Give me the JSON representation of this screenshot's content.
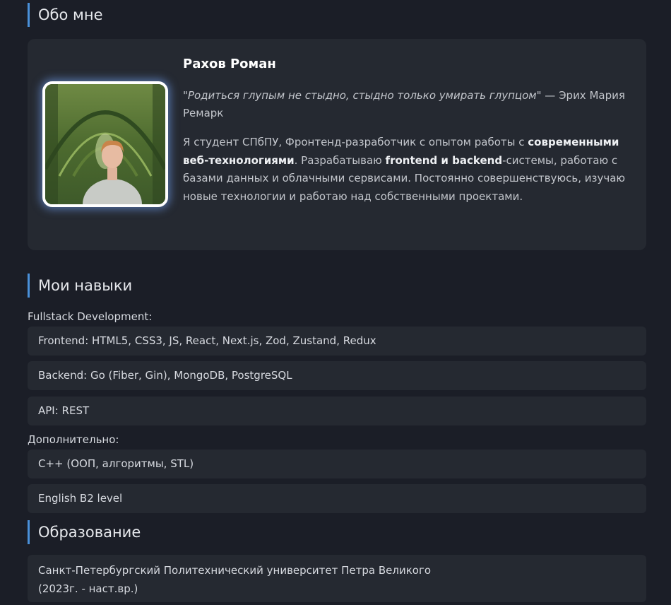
{
  "about": {
    "title": "Обо мне",
    "name": "Рахов Роман",
    "quote": "\"Родиться глупым не стыдно, стыдно только умирать глупцом\"",
    "quote_author": " — Эрих Мария Ремарк",
    "bio": {
      "part1": "Я студент СПбПУ, Фронтенд-разработчик с опытом работы с ",
      "bold1": "современными веб-технологиями",
      "part2": ". Разрабатываю ",
      "bold2": "frontend и backend",
      "part3": "-системы, работаю с базами данных и облачными сервисами. Постоянно совершенствуюсь, изучаю новые технологии и работаю над собственными проектами."
    }
  },
  "skills": {
    "title": "Мои навыки",
    "fullstack_label": "Fullstack Development:",
    "fullstack_items": [
      "Frontend: HTML5, CSS3, JS, React, Next.js, Zod, Zustand, Redux",
      "Backend: Go (Fiber, Gin), MongoDB, PostgreSQL",
      "API: REST"
    ],
    "extra_label": "Дополнительно:",
    "extra_items": [
      "C++ (ООП, алгоритмы, STL)",
      "English B2 level"
    ]
  },
  "education": {
    "title": "Образование",
    "line1": "Санкт-Петербургский Политехнический университет Петра Великого",
    "line2": "(2023г. - наст.вр.)"
  },
  "colors": {
    "background": "#1b1e27",
    "card": "#252931",
    "accent": "#4a90d9"
  }
}
